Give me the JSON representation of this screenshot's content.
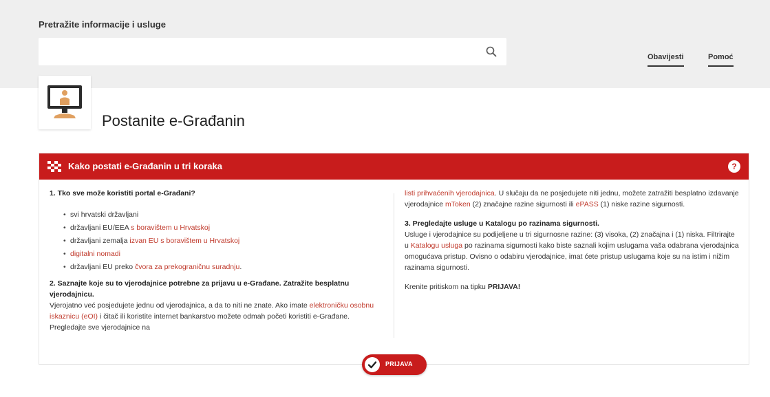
{
  "header": {
    "search_label": "Pretražite informacije i usluge",
    "search_value": "",
    "nav": {
      "notifications": "Obavijesti",
      "help": "Pomoć"
    }
  },
  "page": {
    "title": "Postanite e-Građanin"
  },
  "panel": {
    "title": "Kako postati e-Građanin u tri koraka",
    "help_symbol": "?",
    "step1": {
      "heading": "1. Tko sve može koristiti portal e-Građani?",
      "items": [
        {
          "pre": "svi hrvatski državljani",
          "link": "",
          "post": ""
        },
        {
          "pre": "državljani EU/EEA ",
          "link": "s boravištem u Hrvatskoj",
          "post": ""
        },
        {
          "pre": "državljani zemalja ",
          "link": "izvan EU s boravištem u Hrvatskoj",
          "post": ""
        },
        {
          "pre": "",
          "link": "digitalni nomadi",
          "post": ""
        },
        {
          "pre": "državljani EU preko ",
          "link": "čvora za prekograničnu suradnju",
          "post": "."
        }
      ]
    },
    "step2": {
      "heading": "2. Saznajte koje su to vjerodajnice potrebne za prijavu u e-Građane. Zatražite besplatnu vjerodajnicu.",
      "text1": "Vjerojatno već posjedujete jednu od vjerodajnica, a da to niti ne znate. Ako imate ",
      "link1": "elektroničku osobnu iskaznicu (eOI)",
      "text2": " i čitač ili koristite internet bankarstvo možete odmah početi koristiti e-Građane. Pregledajte sve vjerodajnice na ",
      "link2": "listi prihvaćenih vjerodajnica",
      "text3": ". U slučaju da ne posjedujete niti jednu, možete zatražiti besplatno izdavanje vjerodajnice ",
      "link3": "mToken",
      "text4": " (2) značajne razine sigurnosti ili ",
      "link4": "ePASS",
      "text5": " (1) niske razine sigurnosti."
    },
    "step3": {
      "heading": "3. Pregledajte usluge u Katalogu po razinama sigurnosti.",
      "text1": "Usluge i vjerodajnice su podijeljene u tri sigurnosne razine: (3) visoka, (2) značajna i (1) niska. Filtrirajte u ",
      "link1": "Katalogu usluga",
      "text2": " po razinama sigurnosti kako biste saznali kojim uslugama vaša odabrana vjerodajnica omogućava pristup. Ovisno o odabiru vjerodajnice, imat ćete pristup uslugama koje su na istim i nižim razinama sigurnosti."
    },
    "cta_pre": "Krenite pritiskom na tipku ",
    "cta_bold": "PRIJAVA!"
  },
  "login_button": "PRIJAVA",
  "colors": {
    "brand_red": "#c81c1c",
    "link": "#c0392b",
    "band": "#efefef"
  },
  "icons": {
    "search": "magnifier",
    "logo": "citizen-at-computer",
    "header": "checkered-flag",
    "help": "question-circle",
    "login": "checkmark-circle"
  }
}
